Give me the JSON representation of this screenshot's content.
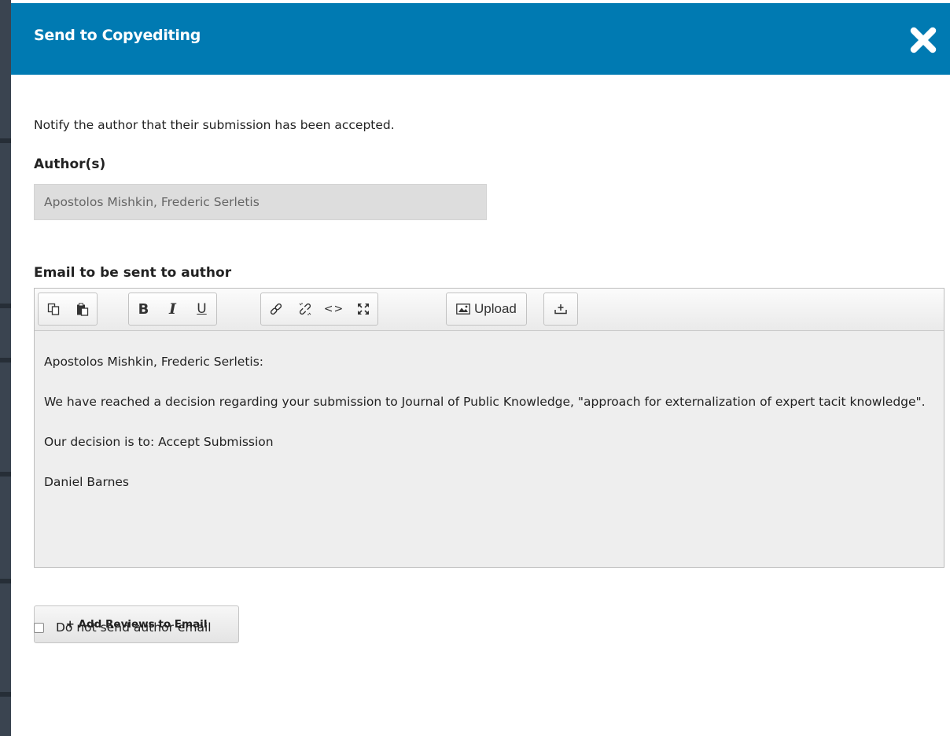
{
  "modal": {
    "title": "Send to Copyediting",
    "intro": "Notify the author that their submission has been accepted."
  },
  "authors": {
    "label": "Author(s)",
    "value": "Apostolos Mishkin, Frederic Serletis"
  },
  "email": {
    "label": "Email to be sent to author",
    "toolbar": {
      "bold": "B",
      "italic": "I",
      "underline": "U",
      "code": "<>",
      "upload": "Upload"
    },
    "body": {
      "greeting": "Apostolos Mishkin, Frederic Serletis:",
      "paragraph1": "We have reached a decision regarding your submission to Journal of Public Knowledge, \"approach for externalization of expert tacit knowledge\".",
      "paragraph2": "Our decision is to: Accept Submission",
      "signature": "Daniel Barnes"
    }
  },
  "add_reviews_button": "+ Add Reviews to Email",
  "skip_email": {
    "label": "Do not send author email",
    "checked": false
  },
  "colors": {
    "header": "#007ab2",
    "editor_bg": "#eeeeee",
    "readonly_input": "#dddddd"
  },
  "icons": [
    "close-icon",
    "copy-icon",
    "paste-icon",
    "link-icon",
    "unlink-icon",
    "code-icon",
    "fullscreen-icon",
    "image-icon",
    "insert-icon"
  ]
}
